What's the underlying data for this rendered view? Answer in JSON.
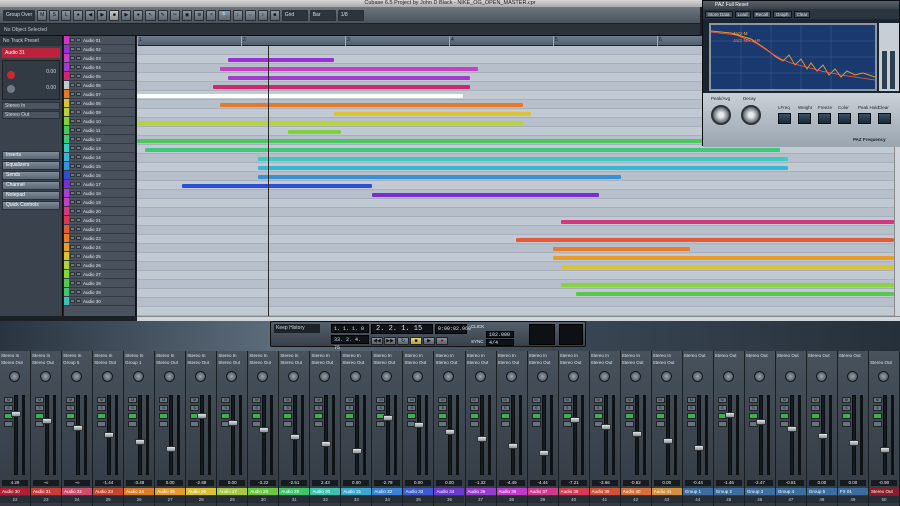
{
  "window": {
    "title": "Cubase 6.5 Project by John D Black - NIKE_OG_OPEN_MASTER.cpr"
  },
  "toolbar": {
    "buttons": [
      "M",
      "S",
      "L",
      "●",
      "◀",
      "▶",
      "■",
      "▶",
      "●",
      "↖",
      "✎",
      "✂",
      "◉",
      "⊕",
      "×",
      "🔍",
      "↕",
      "⇔",
      "♪",
      "■"
    ],
    "dropdowns": [
      "Grid",
      "Bar",
      "1/8"
    ],
    "mode_dropdown": "Group Over"
  },
  "info_line": "No Object Selected",
  "inspector": {
    "header": "No Track Preset",
    "track_name": "Audio 31",
    "rows": [
      "Stereo In",
      "Stereo Out"
    ],
    "value_a": "0.00",
    "value_b": "0.00",
    "sections": [
      "Inserts",
      "Equalizers",
      "Sends",
      "Channel",
      "Notepad",
      "Quick Controls"
    ]
  },
  "tracks": [
    {
      "name": "Audio 01",
      "color": "#d233c9"
    },
    {
      "name": "Audio 02",
      "color": "#9a2fd4"
    },
    {
      "name": "Audio 03",
      "color": "#c63fc6"
    },
    {
      "name": "Audio 04",
      "color": "#a33bcf"
    },
    {
      "name": "Audio 05",
      "color": "#d0266d"
    },
    {
      "name": "Audio 06",
      "color": "#c5c9cc"
    },
    {
      "name": "Audio 07",
      "color": "#e07a2a"
    },
    {
      "name": "Audio 08",
      "color": "#d8c23a"
    },
    {
      "name": "Audio 09",
      "color": "#b8d23c"
    },
    {
      "name": "Audio 10",
      "color": "#7fd23c"
    },
    {
      "name": "Audio 11",
      "color": "#4bc85a"
    },
    {
      "name": "Audio 12",
      "color": "#3ec87a"
    },
    {
      "name": "Audio 13",
      "color": "#3ccac4"
    },
    {
      "name": "Audio 14",
      "color": "#38b6d6"
    },
    {
      "name": "Audio 15",
      "color": "#3a8fd6"
    },
    {
      "name": "Audio 16",
      "color": "#2e4fd4"
    },
    {
      "name": "Audio 17",
      "color": "#7a2fd2"
    },
    {
      "name": "Audio 18",
      "color": "#a93fd0"
    },
    {
      "name": "Audio 19",
      "color": "#c53fc5"
    },
    {
      "name": "Audio 20",
      "color": "#d3377e"
    },
    {
      "name": "Audio 21",
      "color": "#d63a52"
    },
    {
      "name": "Audio 22",
      "color": "#e05a3c"
    },
    {
      "name": "Audio 23",
      "color": "#e57c2e"
    },
    {
      "name": "Audio 24",
      "color": "#e89c2c"
    },
    {
      "name": "Audio 25",
      "color": "#d7c335"
    },
    {
      "name": "Audio 26",
      "color": "#b4d23a"
    },
    {
      "name": "Audio 27",
      "color": "#86d43c"
    },
    {
      "name": "Audio 28",
      "color": "#56c84a"
    },
    {
      "name": "Audio 29",
      "color": "#3fc773"
    },
    {
      "name": "Audio 30",
      "color": "#3ec1b4"
    }
  ],
  "ruler": [
    "1",
    "2",
    "3",
    "4",
    "5",
    "6"
  ],
  "events": [
    {
      "track": 1,
      "color": "#9a2fd4",
      "start": 0.12,
      "end": 0.26
    },
    {
      "track": 2,
      "color": "#c63fc6",
      "start": 0.11,
      "end": 0.45
    },
    {
      "track": 3,
      "color": "#a33bcf",
      "start": 0.12,
      "end": 0.44
    },
    {
      "track": 4,
      "color": "#d0266d",
      "start": 0.1,
      "end": 0.44
    },
    {
      "track": 5,
      "color": "#ffffff",
      "start": 0.0,
      "end": 0.43
    },
    {
      "track": 6,
      "color": "#e07a2a",
      "start": 0.11,
      "end": 0.51
    },
    {
      "track": 7,
      "color": "#d8c23a",
      "start": 0.26,
      "end": 0.52
    },
    {
      "track": 8,
      "color": "#b8d23c",
      "start": 0.0,
      "end": 0.51
    },
    {
      "track": 9,
      "color": "#7fd23c",
      "start": 0.2,
      "end": 0.27
    },
    {
      "track": 10,
      "color": "#4bc85a",
      "start": 0.0,
      "end": 0.86
    },
    {
      "track": 11,
      "color": "#3ec87a",
      "start": 0.01,
      "end": 0.85
    },
    {
      "track": 12,
      "color": "#3ccac4",
      "start": 0.16,
      "end": 0.86
    },
    {
      "track": 13,
      "color": "#38b6d6",
      "start": 0.16,
      "end": 0.86
    },
    {
      "track": 14,
      "color": "#3a8fd6",
      "start": 0.16,
      "end": 0.64
    },
    {
      "track": 15,
      "color": "#2e4fd4",
      "start": 0.06,
      "end": 0.31
    },
    {
      "track": 16,
      "color": "#7a2fd2",
      "start": 0.31,
      "end": 0.61
    },
    {
      "track": 19,
      "color": "#d3377e",
      "start": 0.56,
      "end": 1.0
    },
    {
      "track": 21,
      "color": "#e05a3c",
      "start": 0.5,
      "end": 1.0
    },
    {
      "track": 22,
      "color": "#e57c2e",
      "start": 0.55,
      "end": 0.73
    },
    {
      "track": 23,
      "color": "#e89c2c",
      "start": 0.55,
      "end": 1.0
    },
    {
      "track": 24,
      "color": "#d7c335",
      "start": 0.56,
      "end": 1.0
    },
    {
      "track": 26,
      "color": "#86d43c",
      "start": 0.56,
      "end": 1.0
    },
    {
      "track": 27,
      "color": "#56c84a",
      "start": 0.58,
      "end": 1.0
    }
  ],
  "transport": {
    "history_label": "Keep History",
    "left_locator": "1. 1. 1. 0",
    "right_locator": "33. 2. 4. 75",
    "position_bars": "2. 2. 1. 15",
    "position_time": "0:00:02.960",
    "tempo": "102.000",
    "signature": "4/4",
    "click_label": "CLICK",
    "sync_label": "SYNC"
  },
  "mixer": {
    "channels": [
      {
        "name": "Audio 30",
        "color": "#b01f2f",
        "in": "Stereo In",
        "out": "Stereo Out",
        "vol": "4.29",
        "num": "22"
      },
      {
        "name": "Audio 31",
        "color": "#c93c3c",
        "in": "Stereo In",
        "out": "Stereo Out",
        "vol": "-∞",
        "num": "23"
      },
      {
        "name": "Audio 32",
        "color": "#d24b6a",
        "in": "Stereo In",
        "out": "Group 5",
        "vol": "-∞",
        "num": "24"
      },
      {
        "name": "Audio 23",
        "color": "#c7452f",
        "in": "Stereo In",
        "out": "Stereo Out",
        "vol": "-1.44",
        "num": "25"
      },
      {
        "name": "Audio 24",
        "color": "#dc7d25",
        "in": "Stereo In",
        "out": "Group 1",
        "vol": "-3.48",
        "num": "26"
      },
      {
        "name": "Audio 25",
        "color": "#e59b2a",
        "in": "Stereo In",
        "out": "Stereo Out",
        "vol": "0.00",
        "num": "27"
      },
      {
        "name": "Audio 26",
        "color": "#d9c233",
        "in": "Stereo In",
        "out": "Stereo Out",
        "vol": "-2.88",
        "num": "28"
      },
      {
        "name": "Audio 27",
        "color": "#a7c93b",
        "in": "Stereo In",
        "out": "Stereo Out",
        "vol": "0.00",
        "num": "29"
      },
      {
        "name": "Audio 28",
        "color": "#69c840",
        "in": "Stereo In",
        "out": "Stereo Out",
        "vol": "-3.22",
        "num": "30"
      },
      {
        "name": "Audio 29",
        "color": "#3fc56c",
        "in": "Stereo In",
        "out": "Stereo Out",
        "vol": "-2.51",
        "num": "31"
      },
      {
        "name": "Audio 30",
        "color": "#3cc3b0",
        "in": "Stereo In",
        "out": "Stereo Out",
        "vol": "2.43",
        "num": "32"
      },
      {
        "name": "Audio 31",
        "color": "#3aa9d0",
        "in": "Stereo In",
        "out": "Stereo Out",
        "vol": "0.00",
        "num": "33"
      },
      {
        "name": "Audio 32",
        "color": "#3a82d4",
        "in": "Stereo In",
        "out": "Stereo Out",
        "vol": "-2.78",
        "num": "34"
      },
      {
        "name": "Audio 33",
        "color": "#3a5bd2",
        "in": "Stereo In",
        "out": "Stereo Out",
        "vol": "0.00",
        "num": "35"
      },
      {
        "name": "Audio 34",
        "color": "#6c3ad2",
        "in": "Stereo In",
        "out": "Stereo Out",
        "vol": "0.00",
        "num": "36"
      },
      {
        "name": "Audio 35",
        "color": "#9a3ad0",
        "in": "Stereo In",
        "out": "Stereo Out",
        "vol": "-1.32",
        "num": "37"
      },
      {
        "name": "Audio 36",
        "color": "#c23acb",
        "in": "Stereo In",
        "out": "Stereo Out",
        "vol": "-4.49",
        "num": "38"
      },
      {
        "name": "Audio 37",
        "color": "#d03a8c",
        "in": "Stereo In",
        "out": "Stereo Out",
        "vol": "-4.44",
        "num": "39"
      },
      {
        "name": "Audio 38",
        "color": "#d43a52",
        "in": "Stereo In",
        "out": "Stereo Out",
        "vol": "-7.21",
        "num": "40"
      },
      {
        "name": "Audio 39",
        "color": "#d4503a",
        "in": "Stereo In",
        "out": "Stereo Out",
        "vol": "-3.66",
        "num": "41"
      },
      {
        "name": "Audio 40",
        "color": "#d4703a",
        "in": "Stereo In",
        "out": "Stereo Out",
        "vol": "-0.82",
        "num": "42"
      },
      {
        "name": "Audio 41",
        "color": "#d4903a",
        "in": "Stereo In",
        "out": "Stereo Out",
        "vol": "0.00",
        "num": "43"
      },
      {
        "name": "Group 1",
        "color": "#3b6e9e",
        "in": "Stereo Out",
        "out": "",
        "vol": "-0.44",
        "num": "44"
      },
      {
        "name": "Group 2",
        "color": "#3b6e9e",
        "in": "Stereo Out",
        "out": "",
        "vol": "-1.46",
        "num": "45"
      },
      {
        "name": "Group 3",
        "color": "#3b6e9e",
        "in": "Stereo Out",
        "out": "",
        "vol": "-2.47",
        "num": "46"
      },
      {
        "name": "Group 4",
        "color": "#3b6e9e",
        "in": "Stereo Out",
        "out": "",
        "vol": "-0.81",
        "num": "47"
      },
      {
        "name": "Group 5",
        "color": "#3b6e9e",
        "in": "Stereo Out",
        "out": "",
        "vol": "0.00",
        "num": "48"
      },
      {
        "name": "FX 01",
        "color": "#3b6e9e",
        "in": "Stereo Out",
        "out": "",
        "vol": "0.00",
        "num": "49"
      },
      {
        "name": "Stereo Out",
        "color": "#8b1d2a",
        "in": "",
        "out": "Stereo Out",
        "vol": "-0.90",
        "num": "50"
      }
    ]
  },
  "paz": {
    "title": "PAZ Full Reset",
    "bar": [
      "Store Data",
      "Load",
      "Recall",
      "Graph",
      "Clear"
    ],
    "legend_a": "Jazz-M",
    "legend_b": "Jazz Mix L+R",
    "knob_labels": [
      "Peak/Avg",
      "Decay"
    ],
    "switch_labels": [
      "LFreq",
      "Weight",
      "Freeze",
      "Color",
      "Peak Hold",
      "Clear"
    ],
    "brand": "PAZ Frequency"
  }
}
